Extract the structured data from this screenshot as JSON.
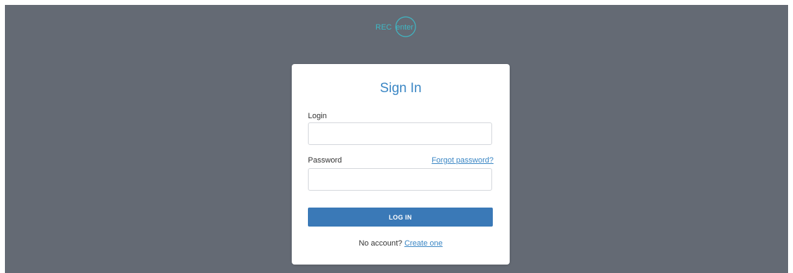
{
  "logo": {
    "prefix": "REC",
    "suffix": "enter",
    "color": "#3fb7c4"
  },
  "colors": {
    "background": "#646a74",
    "accent": "#3a86c4",
    "button": "#3a79b7"
  },
  "signin": {
    "title": "Sign In",
    "login_label": "Login",
    "login_value": "",
    "password_label": "Password",
    "password_value": "",
    "forgot_link": "Forgot password?",
    "submit_label": "LOG IN",
    "no_account_text": "No account?",
    "create_link": "Create one"
  }
}
